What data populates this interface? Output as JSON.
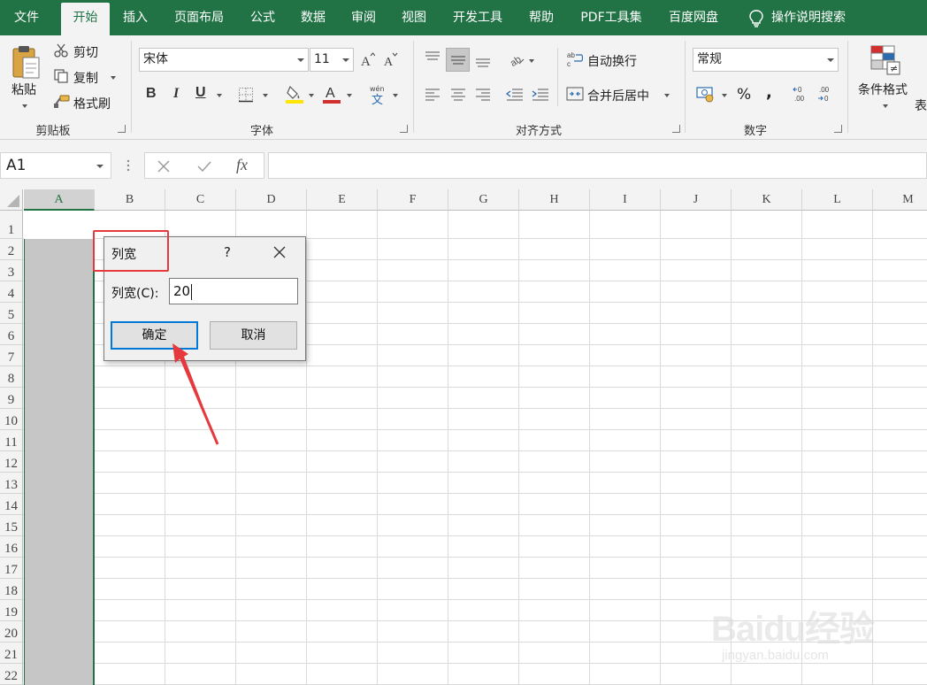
{
  "tabs": [
    {
      "label": "文件",
      "active": false
    },
    {
      "label": "开始",
      "active": true
    },
    {
      "label": "插入",
      "active": false
    },
    {
      "label": "页面布局",
      "active": false
    },
    {
      "label": "公式",
      "active": false
    },
    {
      "label": "数据",
      "active": false
    },
    {
      "label": "审阅",
      "active": false
    },
    {
      "label": "视图",
      "active": false
    },
    {
      "label": "开发工具",
      "active": false
    },
    {
      "label": "帮助",
      "active": false
    },
    {
      "label": "PDF工具集",
      "active": false
    },
    {
      "label": "百度网盘",
      "active": false
    }
  ],
  "search_label": "操作说明搜索",
  "clipboard": {
    "paste": "粘贴",
    "cut": "剪切",
    "copy": "复制",
    "format_painter": "格式刷",
    "group_label": "剪贴板"
  },
  "font": {
    "name": "宋体",
    "size": "11",
    "bold": "B",
    "italic": "I",
    "underline": "U",
    "group_label": "字体",
    "font_color": "#d32f2f",
    "highlight_color": "#ffe600"
  },
  "alignment": {
    "wrap_text": "自动换行",
    "merge_center": "合并后居中",
    "group_label": "对齐方式"
  },
  "number": {
    "format": "常规",
    "percent": "%",
    "comma": ",",
    "group_label": "数字"
  },
  "styles": {
    "conditional_format": "条件格式",
    "truncated_label": "表"
  },
  "formula_bar": {
    "name_box": "A1",
    "fx": "fx",
    "value": ""
  },
  "columns": [
    "A",
    "B",
    "C",
    "D",
    "E",
    "F",
    "G",
    "H",
    "I",
    "J",
    "K",
    "L",
    "M"
  ],
  "rows": [
    "1",
    "2",
    "3",
    "4",
    "5",
    "6",
    "7",
    "8",
    "9",
    "10",
    "11",
    "12",
    "13",
    "14",
    "15",
    "16",
    "17",
    "18",
    "19",
    "20",
    "21",
    "22"
  ],
  "dialog": {
    "title": "列宽",
    "help": "?",
    "field_label": "列宽(C):",
    "field_value": "20",
    "ok": "确定",
    "cancel": "取消"
  },
  "watermark": {
    "brand": "Baidu经验",
    "url": "jingyan.baidu.com"
  },
  "colors": {
    "excel_green": "#217346",
    "annotation_red": "#e5393d",
    "selection_gray": "#c6c6c6"
  }
}
